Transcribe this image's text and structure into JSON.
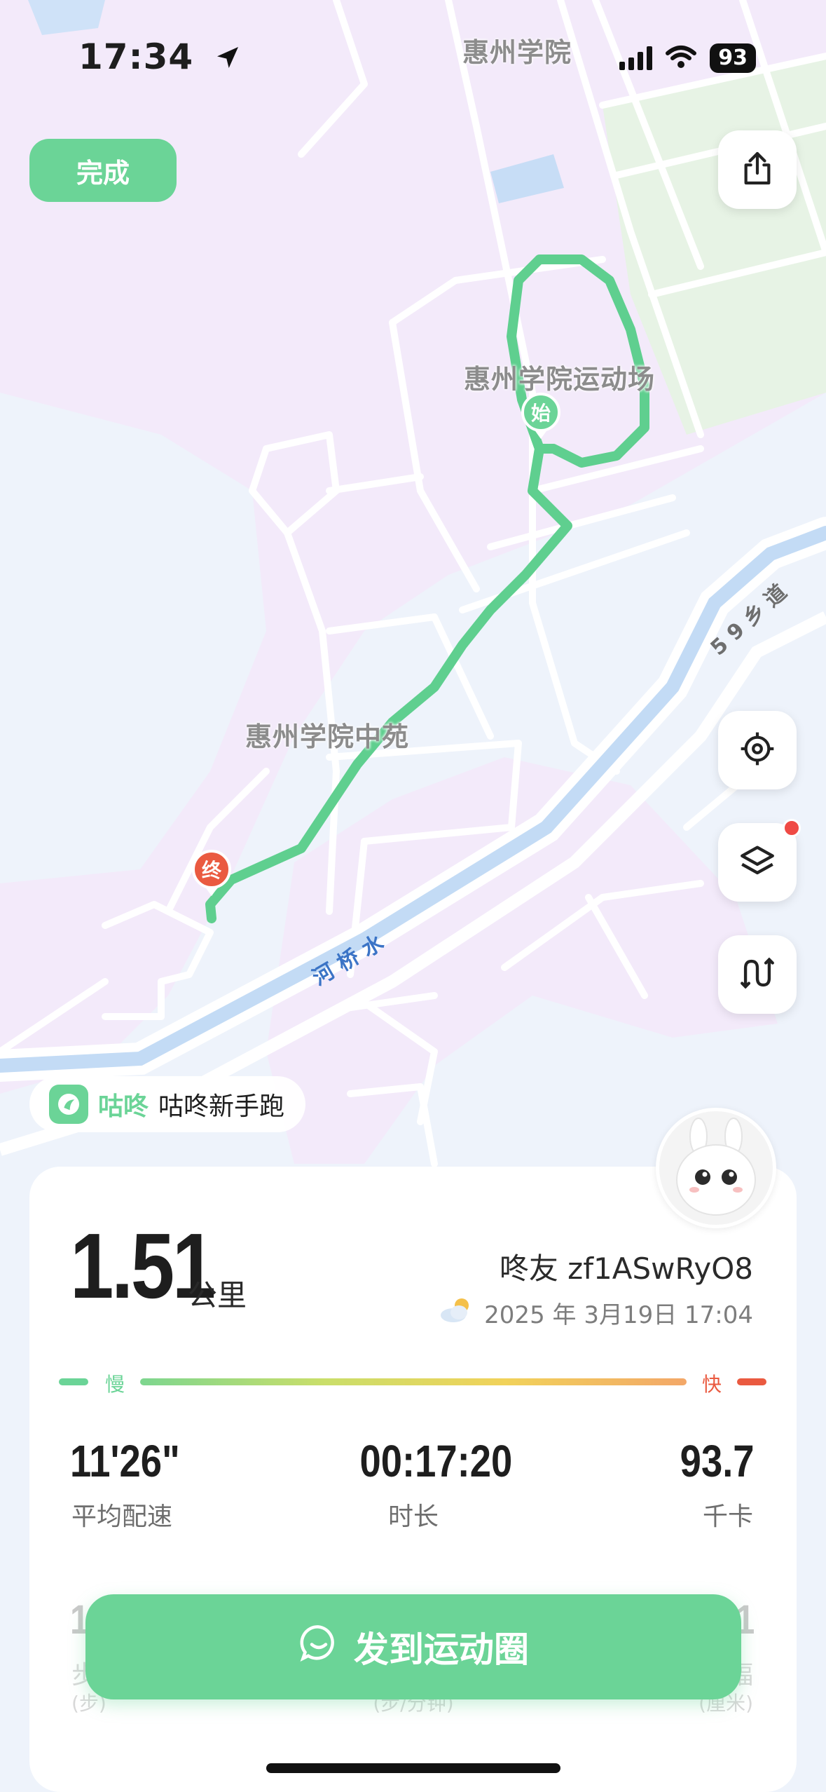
{
  "status_bar": {
    "time": "17:34",
    "battery": "93"
  },
  "top": {
    "done_label": "完成"
  },
  "map": {
    "labels": {
      "campus": "惠州学院",
      "stadium": "惠州学院运动场",
      "garden": "惠州学院中苑",
      "road_59": "5 9 乡 道",
      "river": "河 桥 水"
    },
    "start_marker": "始",
    "end_marker": "终"
  },
  "brand": {
    "name": "咕咚",
    "tag": "咕咚新手跑"
  },
  "summary": {
    "distance": "1.51",
    "distance_unit": "公里",
    "username": "咚友 zf1ASwRyO8",
    "datetime": "2025 年 3月19日 17:04",
    "weather_icon": "partly-cloudy-icon"
  },
  "pace_legend": {
    "slow": "慢",
    "fast": "快"
  },
  "stats": [
    {
      "value": "11'26\"",
      "label": "平均配速"
    },
    {
      "value": "00:17:20",
      "label": "时长"
    },
    {
      "value": "93.7",
      "label": "千卡"
    }
  ],
  "stats_row2_partial": {
    "left_value": "1",
    "left_label": "步",
    "left_unit": "(步)",
    "mid_unit": "(步/分钟)",
    "right_value": "1",
    "right_label": "幅",
    "right_unit": "(厘米)"
  },
  "share": {
    "label": "发到运动圈"
  },
  "colors": {
    "accent": "#6bd497",
    "route": "#5fcf8f",
    "end_pin": "#ea5a40",
    "map_bg": "#f3eafa",
    "water": "#e9f1fb"
  }
}
